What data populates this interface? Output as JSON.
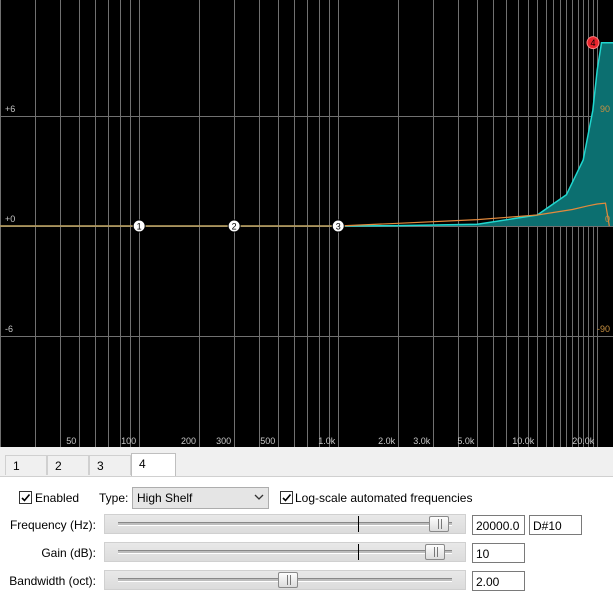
{
  "graph": {
    "x_labels": [
      "50",
      "100",
      "200",
      "300",
      "500",
      "1.0k",
      "2.0k",
      "3.0k",
      "5.0k",
      "10.0k",
      "20.0k"
    ],
    "db_left_labels": [
      "+6",
      "+0",
      "-6"
    ],
    "db_right_labels": [
      "90",
      "0",
      "-90"
    ],
    "bands": [
      "1",
      "2",
      "3",
      "4"
    ],
    "colors": {
      "background": "#000000",
      "grid": "#6e6e6e",
      "response_fill": "#0c6f70",
      "response_line": "#1fd8d0",
      "phase_line": "#e38a3c",
      "node": "#ffffff",
      "selected_node": "#e8242c"
    }
  },
  "chart_data": {
    "type": "line",
    "x_scale": "log",
    "xlim": [
      20,
      24000
    ],
    "ylim": [
      -10,
      10
    ],
    "x_ticks": [
      50,
      100,
      200,
      300,
      500,
      1000,
      2000,
      3000,
      5000,
      10000,
      20000
    ],
    "y_ticks": [
      6,
      0,
      -6
    ],
    "series": [
      {
        "kind": "magnitude (dB)",
        "x": [
          20,
          500,
          1000,
          2000,
          5000,
          10000,
          14000,
          17000,
          19000,
          20000,
          21000,
          22000,
          24000
        ],
        "y": [
          0,
          0,
          0,
          0.02,
          0.1,
          0.6,
          1.7,
          3.6,
          6.3,
          8.5,
          10,
          10,
          10
        ]
      },
      {
        "kind": "phase",
        "x": [
          20,
          1000,
          2000,
          5000,
          10000,
          15000,
          18000,
          20000,
          22000,
          23000
        ],
        "y": [
          0,
          0,
          0.15,
          0.35,
          0.6,
          0.9,
          1.1,
          1.2,
          1.25,
          0
        ]
      }
    ],
    "nodes": [
      {
        "label": "1",
        "freq": 100,
        "gain": 0
      },
      {
        "label": "2",
        "freq": 300,
        "gain": 0
      },
      {
        "label": "3",
        "freq": 1000,
        "gain": 0
      },
      {
        "label": "4",
        "freq": 20000,
        "gain": 10
      }
    ]
  },
  "tabs": [
    {
      "label": "1"
    },
    {
      "label": "2"
    },
    {
      "label": "3"
    },
    {
      "label": "4"
    }
  ],
  "panel": {
    "enabled_label": "Enabled",
    "enabled_checked": true,
    "type_label": "Type:",
    "type_value": "High Shelf",
    "logscale_label": "Log-scale automated frequencies",
    "logscale_checked": true,
    "frequency": {
      "label": "Frequency (Hz):",
      "value": "20000.0",
      "note": "D#10",
      "slider_level": 0.96
    },
    "gain": {
      "label": "Gain (dB):",
      "value": "10",
      "slider_level": 0.95
    },
    "bandwidth": {
      "label": "Bandwidth (oct):",
      "value": "2.00",
      "slider_level": 0.51
    }
  }
}
